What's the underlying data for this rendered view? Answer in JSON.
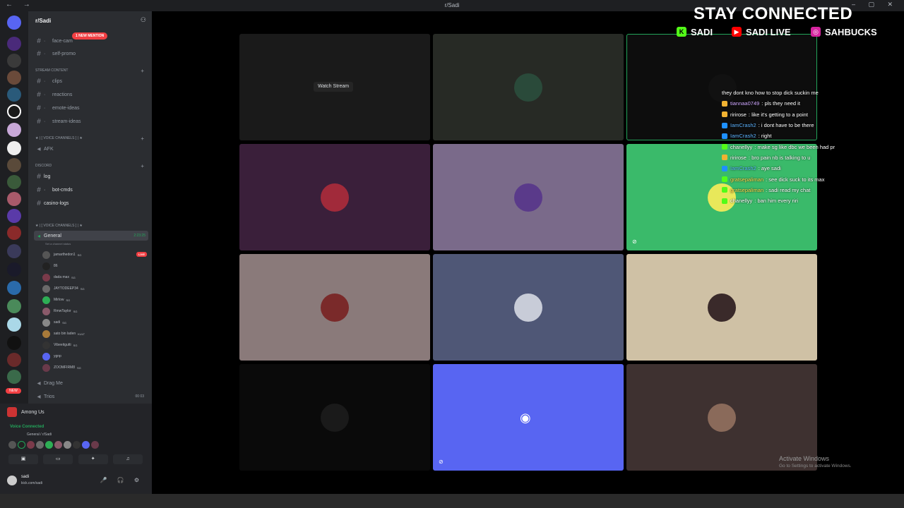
{
  "window": {
    "title": "r/Sadi"
  },
  "server": {
    "name": "r/Sadi"
  },
  "mention_pill": "1 NEW MENTION",
  "text_channels_top": [
    {
      "name": "face-cam"
    },
    {
      "name": "self-promo"
    }
  ],
  "categories": {
    "stream_content": "Stream Content",
    "voice_channels_1": "★ | [ VOICE CHANNELS ] | ★",
    "discord": "Discord",
    "voice_channels_2": "★ | [ VOICE CHANNELS ] | ★"
  },
  "stream_channels": [
    {
      "name": "clips"
    },
    {
      "name": "reactions"
    },
    {
      "name": "emote-ideas"
    },
    {
      "name": "stream-ideas"
    }
  ],
  "afk_channel": "AFK",
  "discord_channels": [
    {
      "name": "log"
    },
    {
      "name": "bot-cmds"
    },
    {
      "name": "casino-logs"
    }
  ],
  "voice_general": {
    "name": "General",
    "timer": "2:23:25",
    "status": "Set a channel status"
  },
  "voice_users": [
    {
      "name": "jamarthedon1",
      "tag": "SG",
      "live": "LIVE",
      "color": "#555"
    },
    {
      "name": "86",
      "tag": "",
      "color": "#222"
    },
    {
      "name": "dada max",
      "tag": "SG",
      "color": "#7a3a4a"
    },
    {
      "name": "JAYTODEEP34",
      "tag": "SG",
      "color": "#6a6a6a"
    },
    {
      "name": "Mirlow",
      "tag": "SG",
      "color": "#2eae55"
    },
    {
      "name": "RmwTaylor",
      "tag": "SG",
      "color": "#8a5a6a"
    },
    {
      "name": "sadi",
      "tag": "SG",
      "color": "#888"
    },
    {
      "name": "sato bin laden",
      "tag": "KULT",
      "color": "#a87a3a"
    },
    {
      "name": "Vibeeitgutti",
      "tag": "SG",
      "color": "#333"
    },
    {
      "name": "ygnp",
      "tag": "",
      "color": "#5865f2"
    },
    {
      "name": "ZOOMFIRM8",
      "tag": "SG",
      "color": "#6a3a4a"
    }
  ],
  "voice_channels_other": [
    {
      "name": "Drag Me"
    },
    {
      "name": "Trios",
      "count": "00 03"
    }
  ],
  "activity": {
    "name": "Among Us"
  },
  "voice_connected": {
    "label": "Voice Connected",
    "sub": "General / r/Sadi"
  },
  "user": {
    "name": "sadi",
    "status": "kick.com/sadi"
  },
  "tiles": [
    {
      "bg": "#1a1a1a",
      "watch": "Watch Stream",
      "avatar": ""
    },
    {
      "bg": "#272a25",
      "avatar": "#2a4a3a"
    },
    {
      "bg": "#0d0d0d",
      "avatar": "#111"
    },
    {
      "bg": "#3a1f3a",
      "avatar": "#a12a3a"
    },
    {
      "bg": "#7a6a8a",
      "avatar": "#5a3a8a"
    },
    {
      "bg": "#3aba6a",
      "avatar": "#e8e85a"
    },
    {
      "bg": "#8a7a7a",
      "avatar": "#7a2a2a"
    },
    {
      "bg": "#4f5776",
      "avatar": "#c8ccd8"
    },
    {
      "bg": "#cfc1a5",
      "avatar": "#3a2a2a"
    },
    {
      "bg": "#0a0a0a",
      "avatar": "#1a1a1a"
    },
    {
      "bg": "#5865f2",
      "avatar": ""
    },
    {
      "bg": "#3e3130",
      "avatar": "#8a6a5a"
    }
  ],
  "overlay": {
    "title": "STAY CONNECTED",
    "socials": [
      {
        "icon": "kick-icon",
        "text": "SADI",
        "color": "#53fc18"
      },
      {
        "icon": "youtube-icon",
        "text": "SADI LIVE",
        "color": "#ff0000"
      },
      {
        "icon": "instagram-icon",
        "text": "SAHBUCKS",
        "color": "#d6249f"
      }
    ]
  },
  "chat": [
    {
      "user": "",
      "msg": "they dont kno how to stop dick suckin me",
      "ucolor": "#fff",
      "badge": ""
    },
    {
      "user": "tiannaa0749",
      "msg": ": pls they need it",
      "ucolor": "#cfa8ff",
      "badge": "#f0b232"
    },
    {
      "user": "ririrose",
      "msg": ": like it's getting to a point",
      "ucolor": "#fff",
      "badge": "#f0b232"
    },
    {
      "user": "IamCrash2",
      "msg": ": i dont have to be there",
      "ucolor": "#5cb3ff",
      "badge": "#1e90ff"
    },
    {
      "user": "IamCrash2",
      "msg": ": right",
      "ucolor": "#5cb3ff",
      "badge": "#1e90ff"
    },
    {
      "user": "chanellyy",
      "msg": ": make sg like dbc we been had pr",
      "ucolor": "#fff",
      "badge": "#53fc18"
    },
    {
      "user": "ririrose",
      "msg": ": bro pain nb is talking to u",
      "ucolor": "#fff",
      "badge": "#f0b232"
    },
    {
      "user": "IamCrash2",
      "msg": ": aye sadi",
      "ucolor": "#5cb3ff",
      "badge": "#1e90ff"
    },
    {
      "user": "gratsepaliman",
      "msg": ": see dick suck to its max",
      "ucolor": "#ffd84a",
      "badge": "#53fc18"
    },
    {
      "user": "gratsepaliman",
      "msg": ": sadi read my chat",
      "ucolor": "#ffd84a",
      "badge": "#53fc18"
    },
    {
      "user": "chanellyy",
      "msg": ": ban him every riri",
      "ucolor": "#fff",
      "badge": "#53fc18"
    }
  ],
  "watermark": {
    "line1": "Activate Windows",
    "line2": "Go to Settings to activate Windows."
  }
}
